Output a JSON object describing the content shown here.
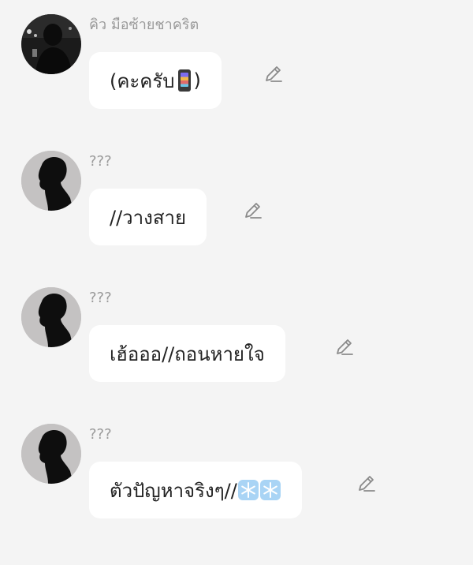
{
  "messages": [
    {
      "sender": "คิว มือซ้ายชาคริต",
      "avatar_icon": "dark-photo-avatar",
      "text_before": "(คะครับ",
      "emoji": "mobile-phone-emoji",
      "text_after": ")",
      "edit_icon": "pencil-icon"
    },
    {
      "sender": "???",
      "avatar_icon": "silhouette-avatar",
      "text": "//วางสาย",
      "edit_icon": "pencil-icon"
    },
    {
      "sender": "???",
      "avatar_icon": "silhouette-avatar",
      "text": "เฮ้อออ//ถอนหายใจ",
      "edit_icon": "pencil-icon"
    },
    {
      "sender": "???",
      "avatar_icon": "silhouette-avatar",
      "text": "ตัวปัญหาจริงๆ//",
      "emoji": "snowflake-emoji",
      "emoji_count": 2,
      "edit_icon": "pencil-icon"
    }
  ],
  "colors": {
    "background": "#f4f4f4",
    "bubble": "#ffffff",
    "name_text": "#9a9a9a",
    "message_text": "#222222",
    "icon": "#8a8a8a"
  }
}
